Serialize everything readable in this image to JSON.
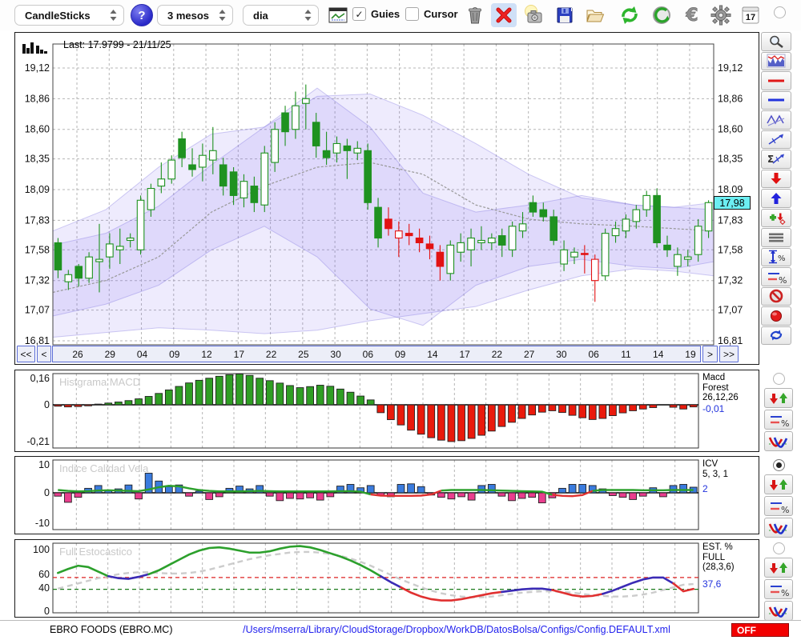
{
  "toolbar": {
    "chart_type": "CandleSticks",
    "help_label": "?",
    "period": "3 mesos",
    "interval": "dia",
    "guies_label": "Guies",
    "guies_checked": true,
    "cursor_label": "Cursor",
    "cursor_checked": false,
    "calendar_day": "17",
    "icon_names": [
      "chart-window-icon",
      "trash-icon",
      "delete-x-icon",
      "camera-icon",
      "save-floppy-icon",
      "open-folder-icon",
      "refresh-icon",
      "undo-icon",
      "euro-icon",
      "gear-icon",
      "calendar-icon"
    ]
  },
  "main_chart": {
    "last_label": "Last: 17.9799 - 21/11/25",
    "current_price": "17,98",
    "price_ticks": [
      "19,12",
      "18,86",
      "18,60",
      "18,35",
      "18,09",
      "17,83",
      "17,58",
      "17,32",
      "17,07",
      "16,81"
    ],
    "nav": {
      "first": "<<",
      "prev": "<",
      "next": ">",
      "last": ">>"
    },
    "date_ticks": [
      "26",
      "29",
      "04",
      "09",
      "12",
      "17",
      "22",
      "25",
      "30",
      "06",
      "09",
      "14",
      "17",
      "22",
      "27",
      "30",
      "06",
      "11",
      "14",
      "19"
    ]
  },
  "panels": [
    {
      "id": "macd",
      "watermark": "Histgrama MACD",
      "yticks": [
        "0,16",
        "0",
        "-0,21"
      ],
      "label": "Macd\nForest\n26,12,26",
      "value": "-0,01",
      "radio_selected": false
    },
    {
      "id": "icv",
      "watermark": "Indice Calidad Vela",
      "yticks": [
        "10",
        "0",
        "-10"
      ],
      "label": "ICV\n5, 3, 1",
      "value": "2",
      "radio_selected": true
    },
    {
      "id": "stoch",
      "watermark": "Full Estocastico",
      "yticks": [
        "100",
        "60",
        "40",
        "0"
      ],
      "label": "EST. %\nFULL\n(28,3,6)",
      "value": "37,6",
      "radio_selected": false
    }
  ],
  "sidebar_tool_names": [
    "zoom-icon",
    "indicator-chart-icon",
    "red-hline-icon",
    "blue-hline-icon",
    "zigzag-icon",
    "trendline-icon",
    "sigma-trend-icon",
    "down-arrow-icon",
    "up-arrow-icon",
    "add-marker-icon",
    "list-lines-icon",
    "vertical-range-percent-icon",
    "levels-percent-icon",
    "forbid-icon",
    "record-icon",
    "sync-icon"
  ],
  "panel_tool_names": [
    "signal-arrows-icon",
    "levels-percent-icon",
    "curves-icon"
  ],
  "statusbar": {
    "symbol": "EBRO FOODS (EBRO.MC)",
    "path": "/Users/mserra/Library/CloudStorage/Dropbox/WorkDB/DatosBolsa/Configs/Config.DEFAULT.xml",
    "off_label": "OFF"
  },
  "colors": {
    "candle_green": "#1f9220",
    "candle_red": "#e21212",
    "band_fill": "rgba(123,104,238,0.13)",
    "band_edge": "rgba(120,110,220,0.35)",
    "macd_green": "#2f9e23",
    "macd_red": "#ea1a0c",
    "icv_blue": "#3a7bde",
    "icv_pink": "#ea3d8e",
    "line_green": "#2ca02c",
    "line_red": "#e03030",
    "stoch_blue": "#3b2bb5",
    "grid": "#b5b5b5",
    "watermark": "#c9c9c9",
    "value_blue": "#2233dd",
    "price_tag_bg": "#6ceef2",
    "off_red": "#f20000"
  },
  "chart_data": [
    {
      "type": "candlestick",
      "title": "EBRO FOODS (EBRO.MC) - 3 mesos, dia",
      "ylim": [
        16.776,
        19.323
      ],
      "ytick_values": [
        19.12,
        18.86,
        18.6,
        18.35,
        18.09,
        17.83,
        17.58,
        17.32,
        17.07,
        16.81
      ],
      "last": 17.9799,
      "last_date": "21/11/25",
      "candles": [
        [
          17.64,
          17.68,
          17.34,
          17.41,
          "g"
        ],
        [
          17.31,
          17.41,
          17.24,
          17.37,
          "G"
        ],
        [
          17.44,
          17.46,
          17.27,
          17.34,
          "g"
        ],
        [
          17.34,
          17.56,
          17.3,
          17.52,
          "G"
        ],
        [
          17.48,
          17.8,
          17.22,
          17.5,
          "G"
        ],
        [
          17.52,
          17.72,
          17.42,
          17.63,
          "G"
        ],
        [
          17.58,
          17.76,
          17.46,
          17.61,
          "G"
        ],
        [
          17.66,
          17.72,
          17.6,
          17.68,
          "G"
        ],
        [
          17.58,
          18.04,
          17.54,
          18.0,
          "G"
        ],
        [
          17.92,
          18.14,
          17.86,
          18.1,
          "G"
        ],
        [
          18.12,
          18.32,
          18.06,
          18.18,
          "G"
        ],
        [
          18.18,
          18.38,
          18.14,
          18.34,
          "G"
        ],
        [
          18.52,
          18.58,
          18.28,
          18.36,
          "g"
        ],
        [
          18.3,
          18.44,
          18.2,
          18.26,
          "g"
        ],
        [
          18.28,
          18.48,
          18.16,
          18.38,
          "G"
        ],
        [
          18.34,
          18.62,
          18.22,
          18.42,
          "G"
        ],
        [
          18.3,
          18.36,
          18.04,
          18.12,
          "g"
        ],
        [
          18.24,
          18.28,
          17.96,
          18.04,
          "g"
        ],
        [
          18.02,
          18.22,
          17.94,
          18.16,
          "G"
        ],
        [
          18.12,
          18.2,
          17.9,
          17.98,
          "g"
        ],
        [
          17.96,
          18.46,
          17.9,
          18.4,
          "G"
        ],
        [
          18.32,
          18.66,
          18.24,
          18.6,
          "G"
        ],
        [
          18.74,
          18.8,
          18.46,
          18.58,
          "g"
        ],
        [
          18.6,
          18.92,
          18.52,
          18.8,
          "G"
        ],
        [
          18.82,
          18.98,
          18.6,
          18.86,
          "G"
        ],
        [
          18.66,
          18.74,
          18.36,
          18.46,
          "g"
        ],
        [
          18.42,
          18.58,
          18.3,
          18.36,
          "g"
        ],
        [
          18.4,
          18.54,
          18.32,
          18.48,
          "G"
        ],
        [
          18.46,
          18.52,
          18.18,
          18.42,
          "g"
        ],
        [
          18.4,
          18.5,
          18.34,
          18.44,
          "G"
        ],
        [
          18.42,
          18.48,
          17.92,
          17.98,
          "g"
        ],
        [
          17.94,
          18.02,
          17.6,
          17.68,
          "g"
        ],
        [
          17.84,
          17.94,
          17.7,
          17.76,
          "r"
        ],
        [
          17.68,
          17.82,
          17.52,
          17.74,
          "R"
        ],
        [
          17.72,
          17.8,
          17.62,
          17.7,
          "r"
        ],
        [
          17.68,
          17.76,
          17.56,
          17.64,
          "r"
        ],
        [
          17.63,
          17.7,
          17.5,
          17.59,
          "r"
        ],
        [
          17.56,
          17.62,
          17.32,
          17.44,
          "r"
        ],
        [
          17.38,
          17.66,
          17.32,
          17.62,
          "G"
        ],
        [
          17.56,
          17.72,
          17.48,
          17.64,
          "G"
        ],
        [
          17.58,
          17.76,
          17.44,
          17.68,
          "G"
        ],
        [
          17.64,
          17.78,
          17.58,
          17.66,
          "G"
        ],
        [
          17.64,
          17.72,
          17.58,
          17.68,
          "G"
        ],
        [
          17.7,
          17.76,
          17.52,
          17.62,
          "g"
        ],
        [
          17.58,
          17.82,
          17.52,
          17.78,
          "G"
        ],
        [
          17.74,
          17.9,
          17.68,
          17.8,
          "G"
        ],
        [
          17.98,
          18.04,
          17.86,
          17.9,
          "g"
        ],
        [
          17.92,
          17.98,
          17.82,
          17.86,
          "g"
        ],
        [
          17.86,
          17.92,
          17.62,
          17.66,
          "g"
        ],
        [
          17.46,
          17.66,
          17.4,
          17.58,
          "G"
        ],
        [
          17.52,
          17.6,
          17.46,
          17.56,
          "G"
        ],
        [
          17.54,
          17.62,
          17.38,
          17.55,
          "r"
        ],
        [
          17.5,
          17.54,
          17.14,
          17.32,
          "R"
        ],
        [
          17.36,
          17.76,
          17.32,
          17.72,
          "G"
        ],
        [
          17.7,
          17.82,
          17.64,
          17.76,
          "G"
        ],
        [
          17.74,
          17.88,
          17.68,
          17.84,
          "G"
        ],
        [
          17.82,
          17.96,
          17.76,
          17.92,
          "G"
        ],
        [
          17.92,
          18.08,
          17.86,
          18.04,
          "G"
        ],
        [
          18.04,
          18.1,
          17.6,
          17.64,
          "g"
        ],
        [
          17.62,
          17.7,
          17.52,
          17.58,
          "g"
        ],
        [
          17.44,
          17.6,
          17.36,
          17.54,
          "G"
        ],
        [
          17.5,
          17.58,
          17.44,
          17.52,
          "G"
        ],
        [
          17.54,
          17.84,
          17.48,
          17.78,
          "G"
        ],
        [
          17.74,
          18.0,
          17.68,
          17.98,
          "G"
        ]
      ],
      "bands": {
        "t": [
          0,
          0.08,
          0.16,
          0.24,
          0.32,
          0.4,
          0.48,
          0.56,
          0.64,
          0.72,
          0.8,
          0.88,
          0.94,
          1
        ],
        "outer_upper": [
          17.62,
          17.72,
          17.95,
          18.3,
          18.62,
          18.88,
          18.9,
          18.72,
          18.48,
          18.22,
          18.02,
          17.96,
          17.94,
          17.92
        ],
        "outer_lower": [
          16.84,
          16.88,
          16.92,
          16.9,
          16.87,
          16.9,
          16.98,
          17.04,
          17.1,
          17.24,
          17.36,
          17.42,
          17.4,
          17.36
        ],
        "inner_upper": [
          17.74,
          17.92,
          18.28,
          18.56,
          18.62,
          18.95,
          18.62,
          18.06,
          17.9,
          17.96,
          18.04,
          17.96,
          17.94,
          17.98
        ],
        "inner_lower": [
          17.02,
          17.12,
          17.28,
          17.58,
          17.78,
          17.52,
          17.08,
          16.94,
          17.28,
          17.44,
          17.5,
          17.44,
          17.42,
          17.48
        ],
        "mid": [
          17.22,
          17.32,
          17.52,
          17.9,
          18.12,
          18.28,
          18.32,
          18.22,
          17.96,
          17.84,
          17.8,
          17.78,
          17.76,
          17.74
        ]
      }
    },
    {
      "type": "bar",
      "title": "Histgrama MACD (26,12,26)",
      "ylim": [
        -0.22,
        0.185
      ],
      "last_value": -0.01,
      "values": [
        -0.008,
        -0.012,
        -0.01,
        -0.006,
        0.004,
        0.01,
        0.016,
        0.024,
        0.034,
        0.048,
        0.065,
        0.085,
        0.105,
        0.125,
        0.14,
        0.152,
        0.163,
        0.172,
        0.176,
        0.168,
        0.152,
        0.138,
        0.124,
        0.11,
        0.098,
        0.104,
        0.112,
        0.106,
        0.09,
        0.072,
        0.05,
        0.028,
        -0.045,
        -0.085,
        -0.115,
        -0.145,
        -0.168,
        -0.188,
        -0.202,
        -0.21,
        -0.205,
        -0.192,
        -0.174,
        -0.15,
        -0.124,
        -0.1,
        -0.078,
        -0.058,
        -0.042,
        -0.034,
        -0.044,
        -0.06,
        -0.074,
        -0.084,
        -0.078,
        -0.062,
        -0.046,
        -0.034,
        -0.024,
        -0.016,
        0,
        -0.014,
        -0.024,
        -0.012
      ]
    },
    {
      "type": "bar",
      "title": "Indice Calidad Vela (5,3,1)",
      "ylim": [
        -12,
        12
      ],
      "last_value": 2,
      "values": [
        -1.2,
        -3.4,
        -1.6,
        1.6,
        2.6,
        0.8,
        1.4,
        2.8,
        -2.2,
        7,
        4.2,
        2.2,
        2.8,
        -1.2,
        0.6,
        -2.4,
        -1.4,
        1.6,
        2.4,
        1.4,
        2.6,
        -1.2,
        -2.8,
        -2,
        -2.2,
        -1.8,
        -2.6,
        -1.4,
        2.4,
        3,
        1.8,
        2.6,
        -1,
        -1.4,
        3,
        3.2,
        2.2,
        -0.8,
        -1.6,
        -2.2,
        -1.4,
        -2.6,
        2.6,
        3,
        -1.2,
        -2.8,
        -2,
        -1.6,
        -3.6,
        -1.8,
        1.6,
        3,
        3,
        2.6,
        1.4,
        -1,
        -1.6,
        -2.4,
        -1.2,
        1.8,
        -1.4,
        2.6,
        3,
        2
      ],
      "line": [
        1.0,
        0.7,
        0.5,
        0.6,
        0.8,
        0.9,
        0.8,
        0.7,
        0.6,
        1.2,
        2.0,
        2.5,
        2.3,
        1.6,
        1.0,
        0.7,
        0.5,
        0.5,
        0.5,
        0.6,
        0.7,
        0.6,
        0.5,
        0.5,
        0.5,
        0.5,
        0.5,
        0.5,
        0.6,
        0.6,
        0.4,
        -0.6,
        -1.0,
        -1.1,
        -1.1,
        -1.1,
        -1.0,
        -0.6,
        0.8,
        1.0,
        1.0,
        1.0,
        1.0,
        0.9,
        0.8,
        0.7,
        0.6,
        0.5,
        0.4,
        -0.7,
        -1.1,
        -1.2,
        -0.8,
        0.7,
        1.0,
        1.0,
        1.0,
        1.0,
        0.9,
        0.9,
        0.9,
        1.0,
        1.0,
        1.0
      ]
    },
    {
      "type": "line",
      "title": "Full Estocastico (28,3,6)",
      "ylim": [
        0,
        110
      ],
      "thresholds": {
        "upper": 55,
        "lower": 37
      },
      "last_value": 37.6,
      "k": [
        62,
        68,
        73,
        71,
        64,
        57,
        54,
        53,
        56,
        60,
        66,
        74,
        82,
        90,
        96,
        100,
        101,
        99,
        96,
        93,
        93,
        95,
        99,
        102,
        103,
        101,
        97,
        92,
        87,
        81,
        74,
        66,
        57,
        48,
        40,
        32,
        26,
        22,
        20,
        20,
        22,
        25,
        28,
        31,
        33,
        35,
        37,
        38,
        38,
        36,
        32,
        28,
        26,
        27,
        30,
        35,
        41,
        47,
        52,
        55,
        55,
        46,
        34,
        37.6
      ],
      "k_zones": [
        [
          0,
          4,
          "g"
        ],
        [
          5,
          8,
          "b"
        ],
        [
          9,
          31,
          "g"
        ],
        [
          32,
          33,
          "b"
        ],
        [
          34,
          43,
          "r"
        ],
        [
          44,
          48,
          "b"
        ],
        [
          49,
          53,
          "r"
        ],
        [
          54,
          60,
          "b"
        ],
        [
          61,
          63,
          "r"
        ]
      ],
      "d": [
        38,
        42,
        46,
        50,
        54,
        57,
        60,
        62,
        63,
        63,
        62,
        61,
        61,
        62,
        64,
        67,
        71,
        75,
        79,
        83,
        86,
        89,
        91,
        93,
        94,
        94,
        93,
        91,
        88,
        84,
        79,
        73,
        66,
        59,
        52,
        46,
        40,
        35,
        31,
        28,
        26,
        25,
        25,
        26,
        28,
        30,
        32,
        33,
        34,
        34,
        33,
        32,
        30,
        28,
        27,
        26,
        26,
        27,
        29,
        32,
        36,
        40,
        44,
        45
      ]
    }
  ]
}
